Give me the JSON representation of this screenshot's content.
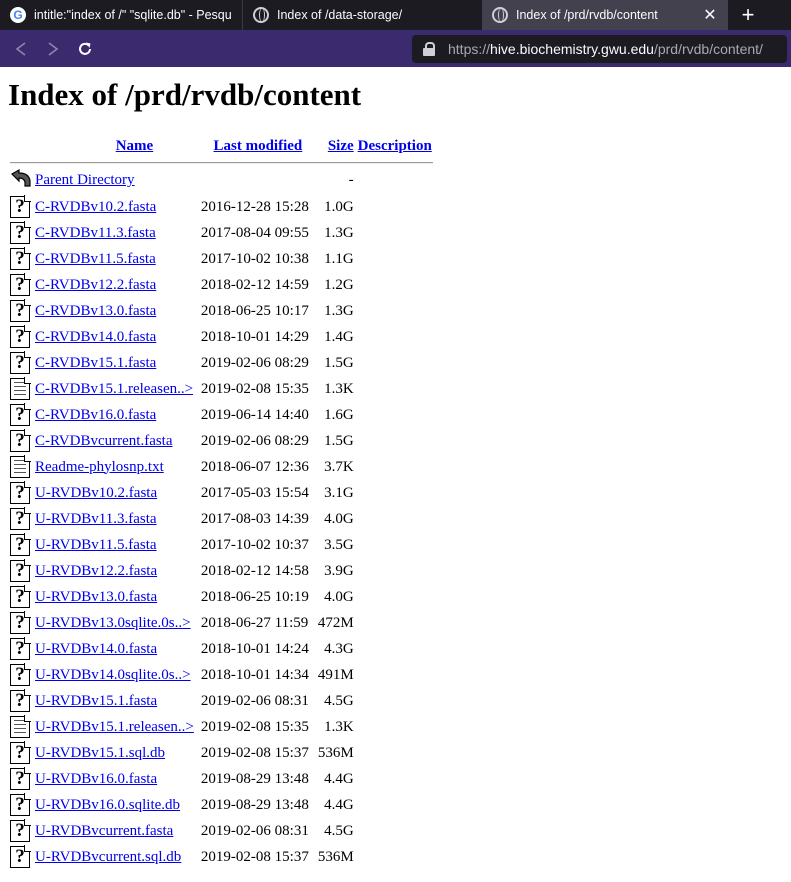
{
  "browser": {
    "tabs": [
      {
        "title": "intitle:\"index of /\" \"sqlite.db\" - Pesquis",
        "icon": "google-icon"
      },
      {
        "title": "Index of /data-storage/",
        "icon": "globe-icon"
      },
      {
        "title": "Index of /prd/rvdb/content",
        "icon": "globe-icon",
        "active": true
      }
    ],
    "new_tab": "+",
    "tab_close": "✕",
    "url_scheme": "https://",
    "url_host": "hive.biochemistry.gwu.edu",
    "url_path": "/prd/rvdb/content/"
  },
  "page": {
    "title": "Index of /prd/rvdb/content",
    "columns": {
      "name": "Name",
      "modified": "Last modified",
      "size": "Size",
      "description": "Description"
    },
    "parent": {
      "name": "Parent Directory",
      "size": "-"
    },
    "rows": [
      {
        "name": "C-RVDBv10.2.fasta",
        "date": "2016-12-28 15:28",
        "size": "1.0G",
        "icon": "unknown"
      },
      {
        "name": "C-RVDBv11.3.fasta",
        "date": "2017-08-04 09:55",
        "size": "1.3G",
        "icon": "unknown"
      },
      {
        "name": "C-RVDBv11.5.fasta",
        "date": "2017-10-02 10:38",
        "size": "1.1G",
        "icon": "unknown"
      },
      {
        "name": "C-RVDBv12.2.fasta",
        "date": "2018-02-12 14:59",
        "size": "1.2G",
        "icon": "unknown"
      },
      {
        "name": "C-RVDBv13.0.fasta",
        "date": "2018-06-25 10:17",
        "size": "1.3G",
        "icon": "unknown"
      },
      {
        "name": "C-RVDBv14.0.fasta",
        "date": "2018-10-01 14:29",
        "size": "1.4G",
        "icon": "unknown"
      },
      {
        "name": "C-RVDBv15.1.fasta",
        "date": "2019-02-06 08:29",
        "size": "1.5G",
        "icon": "unknown"
      },
      {
        "name": "C-RVDBv15.1.releasen..>",
        "date": "2019-02-08 15:35",
        "size": "1.3K",
        "icon": "text"
      },
      {
        "name": "C-RVDBv16.0.fasta",
        "date": "2019-06-14 14:40",
        "size": "1.6G",
        "icon": "unknown"
      },
      {
        "name": "C-RVDBvcurrent.fasta",
        "date": "2019-02-06 08:29",
        "size": "1.5G",
        "icon": "unknown"
      },
      {
        "name": "Readme-phylosnp.txt",
        "date": "2018-06-07 12:36",
        "size": "3.7K",
        "icon": "text"
      },
      {
        "name": "U-RVDBv10.2.fasta",
        "date": "2017-05-03 15:54",
        "size": "3.1G",
        "icon": "unknown"
      },
      {
        "name": "U-RVDBv11.3.fasta",
        "date": "2017-08-03 14:39",
        "size": "4.0G",
        "icon": "unknown"
      },
      {
        "name": "U-RVDBv11.5.fasta",
        "date": "2017-10-02 10:37",
        "size": "3.5G",
        "icon": "unknown"
      },
      {
        "name": "U-RVDBv12.2.fasta",
        "date": "2018-02-12 14:58",
        "size": "3.9G",
        "icon": "unknown"
      },
      {
        "name": "U-RVDBv13.0.fasta",
        "date": "2018-06-25 10:19",
        "size": "4.0G",
        "icon": "unknown"
      },
      {
        "name": "U-RVDBv13.0sqlite.0s..>",
        "date": "2018-06-27 11:59",
        "size": "472M",
        "icon": "unknown"
      },
      {
        "name": "U-RVDBv14.0.fasta",
        "date": "2018-10-01 14:24",
        "size": "4.3G",
        "icon": "unknown"
      },
      {
        "name": "U-RVDBv14.0sqlite.0s..>",
        "date": "2018-10-01 14:34",
        "size": "491M",
        "icon": "unknown"
      },
      {
        "name": "U-RVDBv15.1.fasta",
        "date": "2019-02-06 08:31",
        "size": "4.5G",
        "icon": "unknown"
      },
      {
        "name": "U-RVDBv15.1.releasen..>",
        "date": "2019-02-08 15:35",
        "size": "1.3K",
        "icon": "text"
      },
      {
        "name": "U-RVDBv15.1.sql.db",
        "date": "2019-02-08 15:37",
        "size": "536M",
        "icon": "unknown"
      },
      {
        "name": "U-RVDBv16.0.fasta",
        "date": "2019-08-29 13:48",
        "size": "4.4G",
        "icon": "unknown"
      },
      {
        "name": "U-RVDBv16.0.sqlite.db",
        "date": "2019-08-29 13:48",
        "size": "4.4G",
        "icon": "unknown"
      },
      {
        "name": "U-RVDBvcurrent.fasta",
        "date": "2019-02-06 08:31",
        "size": "4.5G",
        "icon": "unknown"
      },
      {
        "name": "U-RVDBvcurrent.sql.db",
        "date": "2019-02-08 15:37",
        "size": "536M",
        "icon": "unknown"
      }
    ]
  }
}
